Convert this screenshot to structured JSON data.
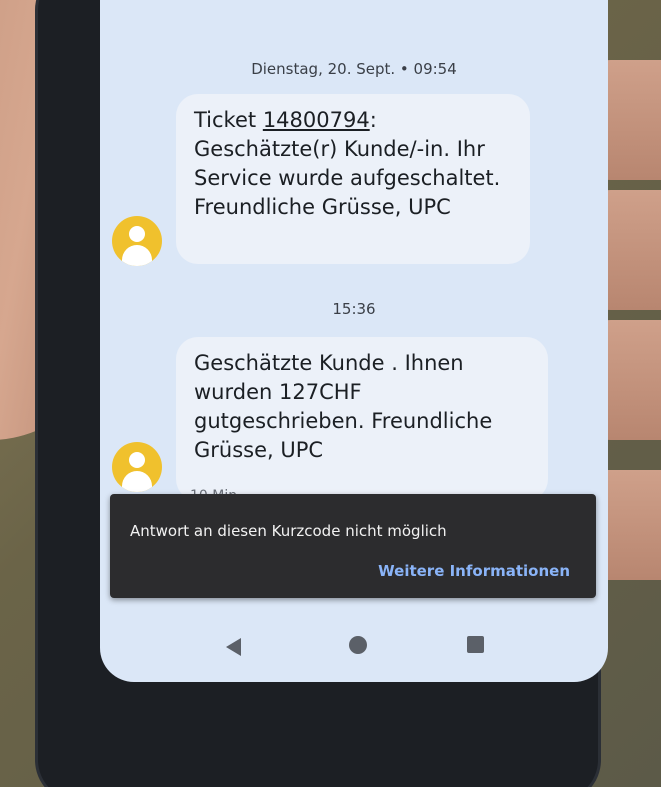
{
  "timestamps": {
    "first": "Dienstag, 20. Sept. • 09:54",
    "second": "15:36"
  },
  "messages": [
    {
      "ticket_prefix": "Ticket ",
      "ticket_number": "14800794",
      "ticket_suffix": ":",
      "text": "Geschätzte(r) Kunde/-in. Ihr Service wurde aufgeschaltet. Freundliche Grüsse, UPC"
    },
    {
      "text": "Geschätzte Kunde . Ihnen wurden 127CHF gutgeschrieben. Freundliche Grüsse, UPC"
    }
  ],
  "peek_text": "10 Min.",
  "snackbar": {
    "message": "Antwort an diesen Kurzcode nicht möglich",
    "action": "Weitere Informationen"
  },
  "colors": {
    "avatar": "#f0c12d",
    "screen_background": "#dbe7f7",
    "bubble": "#ecf1f9",
    "snackbar": "#2c2c2e",
    "snackbar_action": "#8ab4f8"
  },
  "icons": {
    "avatar": "person-icon",
    "back": "back-triangle-icon",
    "home": "home-circle-icon",
    "recent": "recents-square-icon"
  }
}
